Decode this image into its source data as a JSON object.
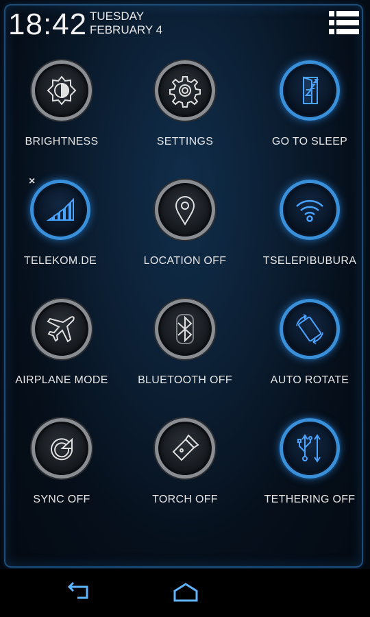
{
  "status": {
    "time": "18:42",
    "day": "TUESDAY",
    "date": "FEBRUARY 4"
  },
  "colors": {
    "accent": "#3a8fd9",
    "icon_on": "#4aa3ff",
    "icon_off": "#e0e0e0"
  },
  "tiles": [
    {
      "label": "BRIGHTNESS",
      "icon": "brightness-icon",
      "active": false
    },
    {
      "label": "SETTINGS",
      "icon": "gear-icon",
      "active": false
    },
    {
      "label": "GO TO SLEEP",
      "icon": "sleep-door-icon",
      "active": true
    },
    {
      "label": "TELEKOM.DE",
      "icon": "signal-bars-icon",
      "active": true
    },
    {
      "label": "LOCATION OFF",
      "icon": "location-pin-icon",
      "active": false
    },
    {
      "label": "TSELEPIBUBURA",
      "icon": "wifi-icon",
      "active": true
    },
    {
      "label": "AIRPLANE MODE",
      "icon": "airplane-icon",
      "active": false
    },
    {
      "label": "BLUETOOTH OFF",
      "icon": "bluetooth-icon",
      "active": false
    },
    {
      "label": "AUTO ROTATE",
      "icon": "rotate-icon",
      "active": true
    },
    {
      "label": "SYNC OFF",
      "icon": "sync-icon",
      "active": false
    },
    {
      "label": "TORCH OFF",
      "icon": "flashlight-icon",
      "active": false
    },
    {
      "label": "TETHERING OFF",
      "icon": "usb-icon",
      "active": true
    }
  ],
  "badge": "×"
}
